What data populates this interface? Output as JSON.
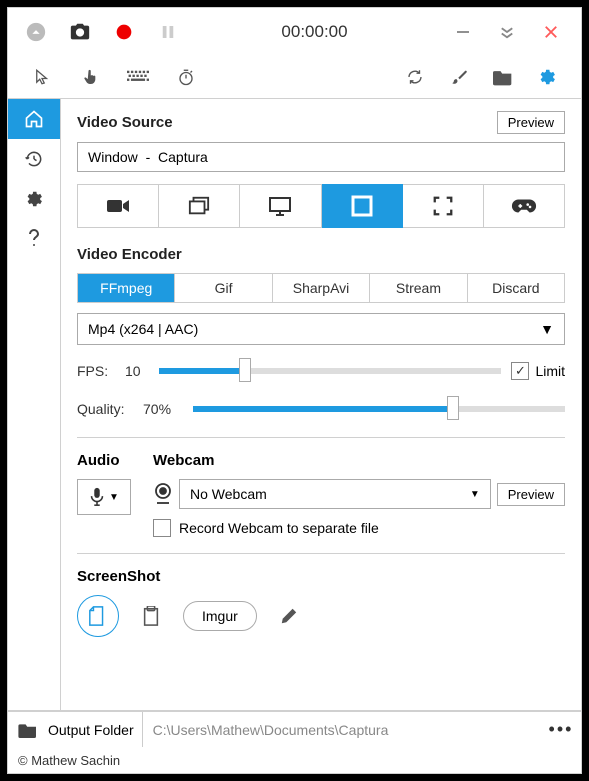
{
  "titlebar": {
    "timer": "00:00:00"
  },
  "source": {
    "title": "Video Source",
    "preview": "Preview",
    "value": "Window  -  Captura"
  },
  "encoder": {
    "title": "Video Encoder",
    "tabs": [
      "FFmpeg",
      "Gif",
      "SharpAvi",
      "Stream",
      "Discard"
    ],
    "active_tab": 0,
    "codec": "Mp4 (x264 | AAC)",
    "fps_label": "FPS:",
    "fps_value": "10",
    "fps_pct": 25,
    "limit_label": "Limit",
    "limit_checked": "✓",
    "quality_label": "Quality:",
    "quality_value": "70%",
    "quality_pct": 70
  },
  "audio": {
    "title": "Audio"
  },
  "webcam": {
    "title": "Webcam",
    "value": "No Webcam",
    "preview": "Preview",
    "separate_label": "Record Webcam to separate file"
  },
  "screenshot": {
    "title": "ScreenShot",
    "imgur": "Imgur"
  },
  "footer": {
    "label": "Output Folder",
    "path": "C:\\Users\\Mathew\\Documents\\Captura",
    "dots": "•••"
  },
  "copyright": "© Mathew Sachin"
}
